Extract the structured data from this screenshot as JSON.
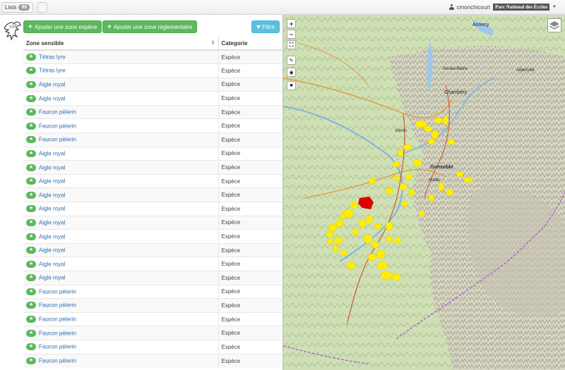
{
  "navbar": {
    "lists_label": "Lists",
    "lists_count": "89",
    "username": "cmonchicourt",
    "organization": "Parc National des Écrins"
  },
  "toolbar": {
    "add_species_zone": "Ajouter une zone espèce",
    "add_regulated_zone": "Ajouter une zone réglementaire",
    "filter": "Filtre"
  },
  "table": {
    "headers": [
      "Zone sensible",
      "Categorie"
    ],
    "rows": [
      {
        "zone": "Tétras lyre",
        "category": "Espèce"
      },
      {
        "zone": "Tétras lyre",
        "category": "Espèce"
      },
      {
        "zone": "Aigle royal",
        "category": "Espèce"
      },
      {
        "zone": "Aigle royal",
        "category": "Espèce"
      },
      {
        "zone": "Faucon pèlerin",
        "category": "Espèce"
      },
      {
        "zone": "Faucon pèlerin",
        "category": "Espèce"
      },
      {
        "zone": "Faucon pèlerin",
        "category": "Espèce"
      },
      {
        "zone": "Aigle royal",
        "category": "Espèce"
      },
      {
        "zone": "Aigle royal",
        "category": "Espèce"
      },
      {
        "zone": "Aigle royal",
        "category": "Espèce"
      },
      {
        "zone": "Aigle royal",
        "category": "Espèce"
      },
      {
        "zone": "Aigle royal",
        "category": "Espèce"
      },
      {
        "zone": "Aigle royal",
        "category": "Espèce"
      },
      {
        "zone": "Aigle royal",
        "category": "Espèce"
      },
      {
        "zone": "Aigle royal",
        "category": "Espèce"
      },
      {
        "zone": "Aigle royal",
        "category": "Espèce"
      },
      {
        "zone": "Aigle royal",
        "category": "Espèce"
      },
      {
        "zone": "Faucon pèlerin",
        "category": "Espèce"
      },
      {
        "zone": "Faucon pèlerin",
        "category": "Espèce"
      },
      {
        "zone": "Faucon pèlerin",
        "category": "Espèce"
      },
      {
        "zone": "Faucon pèlerin",
        "category": "Espèce"
      },
      {
        "zone": "Faucon pèlerin",
        "category": "Espèce"
      },
      {
        "zone": "Faucon pèlerin",
        "category": "Espèce"
      }
    ]
  },
  "map": {
    "labels": [
      "Annecy",
      "Chambéry",
      "Grenoble",
      "Voiron",
      "Vizille",
      "Aix-les-Bains",
      "Albertville"
    ],
    "controls": {
      "zoom_in": "+",
      "zoom_out": "−"
    },
    "colors": {
      "zone_fill": "#ffee00",
      "selected_zone": "#e00000",
      "park_boundary": "#b05ad0"
    }
  },
  "icons": {
    "logo": "eagle-icon",
    "row": "star-icon",
    "user": "user-icon",
    "filter": "funnel-icon",
    "layers": "layers-icon"
  }
}
